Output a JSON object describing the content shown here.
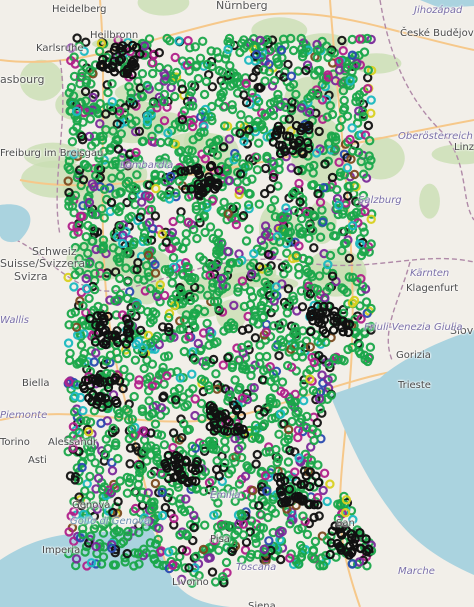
{
  "map": {
    "places": [
      {
        "name": "Heidelberg",
        "class": ""
      },
      {
        "name": "Nürnberg",
        "class": "big"
      },
      {
        "name": "Jihozápad",
        "class": "italic"
      },
      {
        "name": "Karlsruhe",
        "class": ""
      },
      {
        "name": "Heilbronn",
        "class": ""
      },
      {
        "name": "České Budějov",
        "class": ""
      },
      {
        "name": "asbourg",
        "class": "big"
      },
      {
        "name": "Oberösterreich",
        "class": "italic"
      },
      {
        "name": "Freiburg im Breisgau",
        "class": ""
      },
      {
        "name": "Linz",
        "class": ""
      },
      {
        "name": "Salzburg",
        "class": "italic"
      },
      {
        "name": "Schweiz",
        "class": "big"
      },
      {
        "name": "Suisse/Svizzera",
        "class": "big"
      },
      {
        "name": "Svizra",
        "class": "big"
      },
      {
        "name": "Kärnten",
        "class": "italic"
      },
      {
        "name": "Klagenfurt",
        "class": ""
      },
      {
        "name": "Wallis",
        "class": "italic"
      },
      {
        "name": "Slov",
        "class": "big"
      },
      {
        "name": "Biella",
        "class": ""
      },
      {
        "name": "Gorizia",
        "class": ""
      },
      {
        "name": "Trieste",
        "class": ""
      },
      {
        "name": "Piemonte",
        "class": "italic"
      },
      {
        "name": "Torino",
        "class": ""
      },
      {
        "name": "Alessandr",
        "class": ""
      },
      {
        "name": "Asti",
        "class": ""
      },
      {
        "name": "Genova",
        "class": ""
      },
      {
        "name": "Golfo di Genova",
        "class": "sea"
      },
      {
        "name": "Imperia",
        "class": ""
      },
      {
        "name": "Livorno",
        "class": ""
      },
      {
        "name": "Siena",
        "class": ""
      },
      {
        "name": "Toscana",
        "class": "italic"
      },
      {
        "name": "Marche",
        "class": "italic"
      },
      {
        "name": "San",
        "class": ""
      },
      {
        "name": "Pisa",
        "class": ""
      },
      {
        "name": "Friuli-Venezia Giulia",
        "class": "italic"
      },
      {
        "name": "Emilia",
        "class": "italic"
      },
      {
        "name": "Lombardia",
        "class": "italic"
      }
    ],
    "marker_colors": {
      "primary": "#1aa64a",
      "dark": "#111111",
      "purple": "#7a2a9a",
      "magenta": "#b0208a",
      "cyan": "#1ab8c0",
      "blue": "#2a4ab0",
      "yellow": "#d8d020",
      "brown": "#7a4a20"
    },
    "base_colors": {
      "land": "#f2efe9",
      "forest": "#c9dfb3",
      "water": "#aad3df",
      "border": "#b08aa8",
      "road": "#f6c88a"
    }
  }
}
